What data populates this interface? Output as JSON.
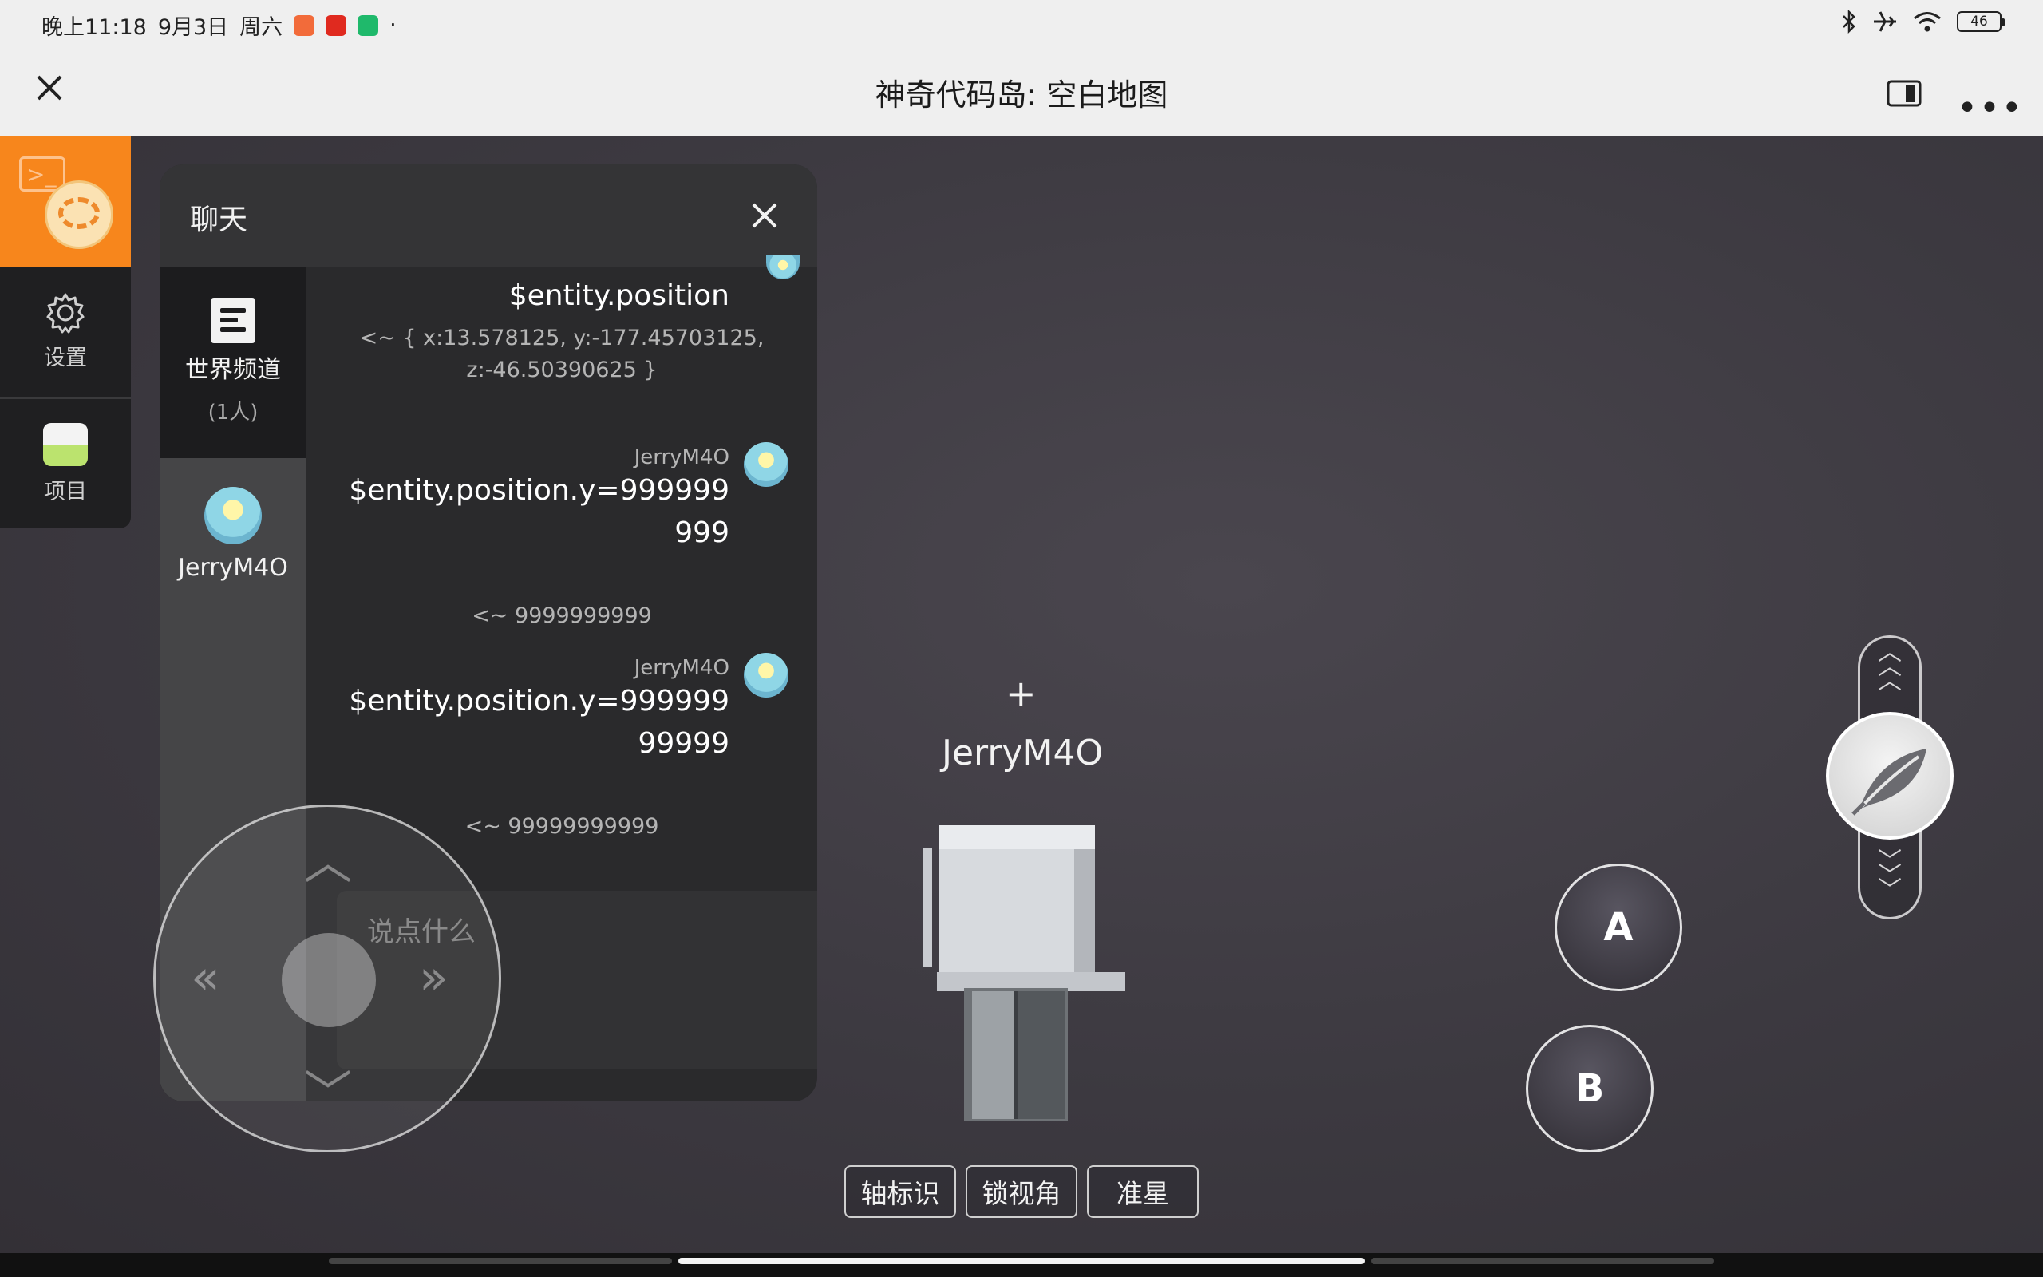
{
  "status_bar": {
    "time": "晚上11:18",
    "date": "9月3日",
    "weekday": "周六",
    "dot": "·",
    "battery": "46"
  },
  "title_bar": {
    "title": "神奇代码岛: 空白地图"
  },
  "left_rail": {
    "settings_label": "设置",
    "project_label": "项目"
  },
  "chat": {
    "title": "聊天",
    "channel": {
      "name": "世界频道",
      "count": "(1人)"
    },
    "user": {
      "name": "JerryM4O"
    },
    "messages": [
      {
        "command": "$entity.position",
        "result": "<~ { x:13.578125, y:-177.45703125, z:-46.50390625 }"
      },
      {
        "sender": "JerryM4O",
        "command": "$entity.position.y=999999999",
        "result": "<~ 9999999999"
      },
      {
        "sender": "JerryM4O",
        "command": "$entity.position.y=99999999999",
        "result": "<~ 99999999999"
      }
    ],
    "input_placeholder": "说点什么"
  },
  "game": {
    "crosshair": "+",
    "player_name": "JerryM4O",
    "button_a": "A",
    "button_b": "B",
    "toolbar": {
      "axis": "轴标识",
      "lock_view": "锁视角",
      "crosshair": "准星"
    }
  },
  "colors": {
    "accent": "#f7861c",
    "scene": "#3d3a41",
    "panel": "#2a2a2c"
  }
}
